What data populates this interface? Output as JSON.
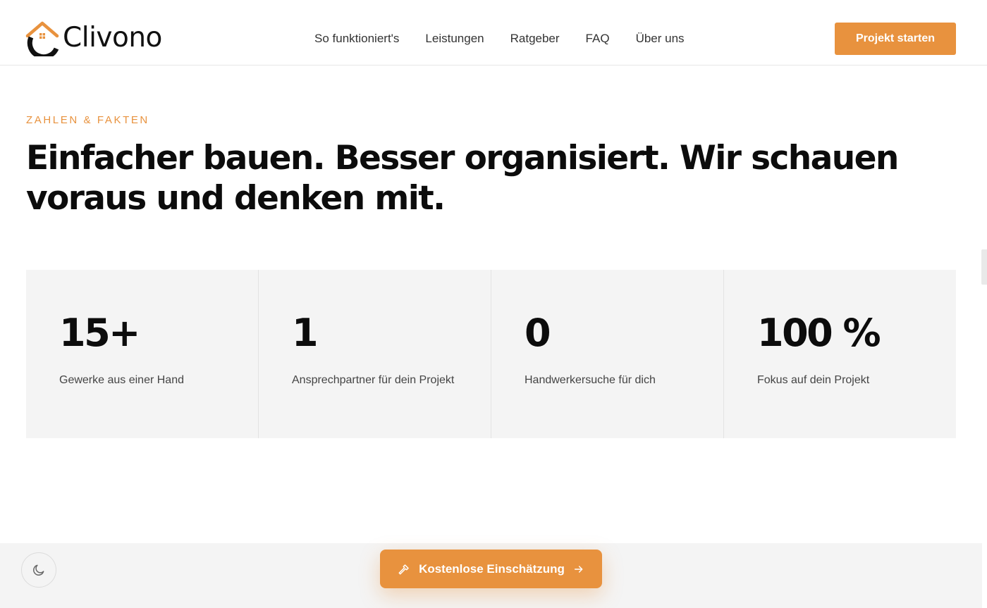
{
  "brand": {
    "name": "Clivono",
    "accent": "#e8923e"
  },
  "nav": {
    "links": [
      {
        "label": "So funktioniert's"
      },
      {
        "label": "Leistungen"
      },
      {
        "label": "Ratgeber"
      },
      {
        "label": "FAQ"
      },
      {
        "label": "Über uns"
      }
    ],
    "cta_label": "Projekt starten"
  },
  "section": {
    "eyebrow": "ZAHLEN & FAKTEN",
    "headline": "Einfacher bauen. Besser organisiert. Wir schauen voraus und denken mit."
  },
  "stats": [
    {
      "value": "15+",
      "label": "Gewerke aus einer Hand"
    },
    {
      "value": "1",
      "label": "Ansprechpartner für dein Projekt"
    },
    {
      "value": "0",
      "label": "Handwerkersuche für dich"
    },
    {
      "value": "100 %",
      "label": "Fokus auf dein Projekt"
    }
  ],
  "floating_cta": {
    "label": "Kostenlose Einschätzung",
    "icon": "hammer-icon",
    "trailing_icon": "arrow-right-icon"
  },
  "theme_toggle": {
    "icon": "moon-icon"
  }
}
